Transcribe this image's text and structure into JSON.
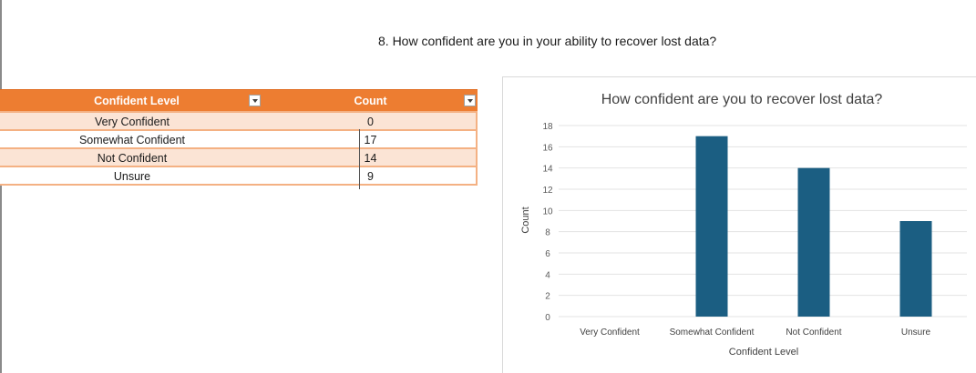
{
  "question": "8. How confident are you in your ability to recover lost data?",
  "table": {
    "headers": [
      "Confident Level",
      "Count"
    ],
    "rows": [
      {
        "level": "Very Confident",
        "count": "0"
      },
      {
        "level": "Somewhat Confident",
        "count": "17"
      },
      {
        "level": "Not Confident",
        "count": "14"
      },
      {
        "level": "Unsure",
        "count": "9"
      }
    ]
  },
  "colors": {
    "header": "#ed7d31",
    "band": "#fbe4d5",
    "bar": "#1b5e82"
  },
  "chart_data": {
    "type": "bar",
    "title": "How confident are you to recover lost data?",
    "xlabel": "Confident Level",
    "ylabel": "Count",
    "categories": [
      "Very Confident",
      "Somewhat Confident",
      "Not Confident",
      "Unsure"
    ],
    "values": [
      0,
      17,
      14,
      9
    ],
    "ylim": [
      0,
      18
    ],
    "yticks": [
      0,
      2,
      4,
      6,
      8,
      10,
      12,
      14,
      16,
      18
    ],
    "grid": true,
    "legend": "none"
  }
}
